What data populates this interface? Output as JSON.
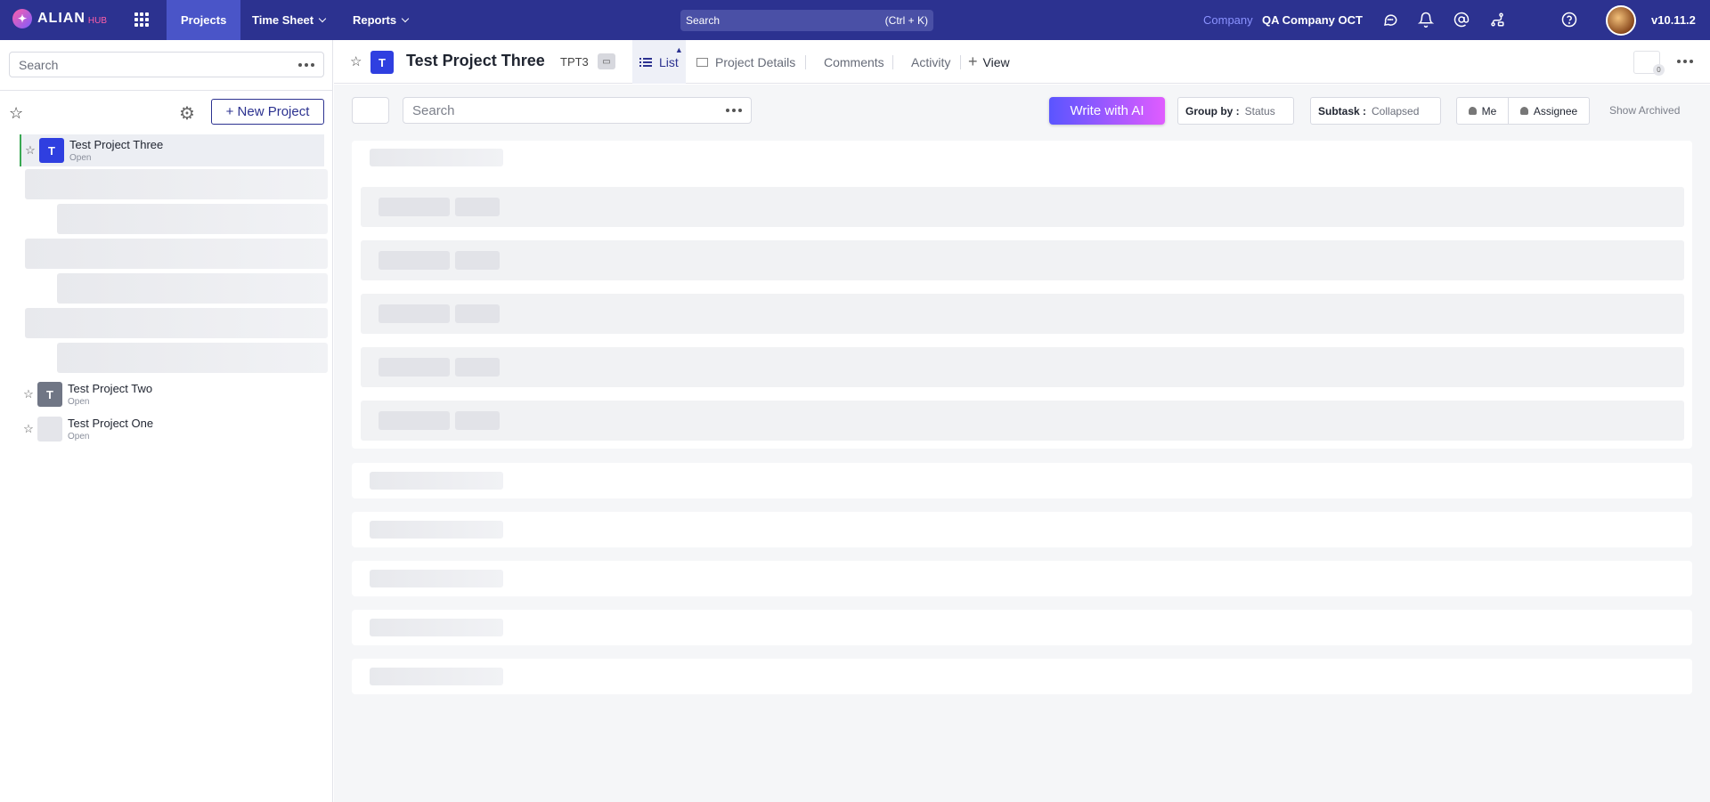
{
  "app": {
    "logo_text": "ALIAN",
    "logo_sub": "HUB",
    "version": "v10.11.2"
  },
  "topnav": {
    "items": [
      {
        "label": "Projects"
      },
      {
        "label": "Time Sheet"
      },
      {
        "label": "Reports"
      }
    ],
    "search_placeholder": "Search",
    "search_shortcut": "(Ctrl + K)",
    "company_label": "Company",
    "company_name": "QA Company OCT",
    "icons": [
      "chat-icon",
      "bell-icon",
      "mention-icon",
      "workflow-icon",
      "help-icon"
    ]
  },
  "sidebar": {
    "search_placeholder": "Search",
    "new_project_label": "+ New Project",
    "projects": [
      {
        "initial": "T",
        "name": "Test Project Three",
        "status": "Open",
        "color": "#2f3fe0"
      },
      {
        "initial": "T",
        "name": "Test Project Two",
        "status": "Open",
        "color": "#707685"
      },
      {
        "initial": "",
        "name": "Test Project One",
        "status": "Open",
        "color": "#e4e5ea"
      }
    ]
  },
  "header": {
    "initial": "T",
    "title": "Test Project Three",
    "code": "TPT3",
    "tabs": [
      {
        "label": "List"
      },
      {
        "label": "Project Details"
      },
      {
        "label": "Comments"
      },
      {
        "label": "Activity"
      },
      {
        "label": "View"
      }
    ],
    "counter": "0"
  },
  "toolbar": {
    "search_placeholder": "Search",
    "ai_label": "Write with AI",
    "group_by_label": "Group by :",
    "group_by_value": "Status",
    "subtask_label": "Subtask :",
    "subtask_value": "Collapsed",
    "me_label": "Me",
    "assignee_label": "Assignee",
    "show_archived": "Show Archived"
  },
  "colors": {
    "topbar": "#2c3290",
    "accent": "#2c3290",
    "active_border": "#39a852"
  }
}
